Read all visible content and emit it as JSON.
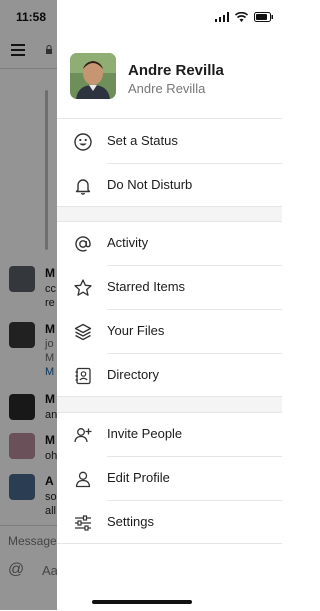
{
  "background": {
    "time": "11:58",
    "message_initials": [
      "M",
      "M",
      "M",
      "M",
      "A"
    ],
    "message_snippets": [
      "cc",
      "re",
      "jo",
      "M",
      "M",
      "an",
      "M",
      "oh",
      "so",
      "all"
    ],
    "composer_placeholder": "Message",
    "composer_at": "@",
    "composer_format": "Aa"
  },
  "profile": {
    "display_name": "Andre Revilla",
    "username": "Andre Revilla"
  },
  "menu": {
    "set_status": "Set a Status",
    "do_not_disturb": "Do Not Disturb",
    "activity": "Activity",
    "starred_items": "Starred Items",
    "your_files": "Your Files",
    "directory": "Directory",
    "invite_people": "Invite People",
    "edit_profile": "Edit Profile",
    "settings": "Settings"
  },
  "colors": {
    "overlay": "#000000",
    "text": "#1d1c1d",
    "muted": "#777777",
    "link": "#1264a3"
  }
}
